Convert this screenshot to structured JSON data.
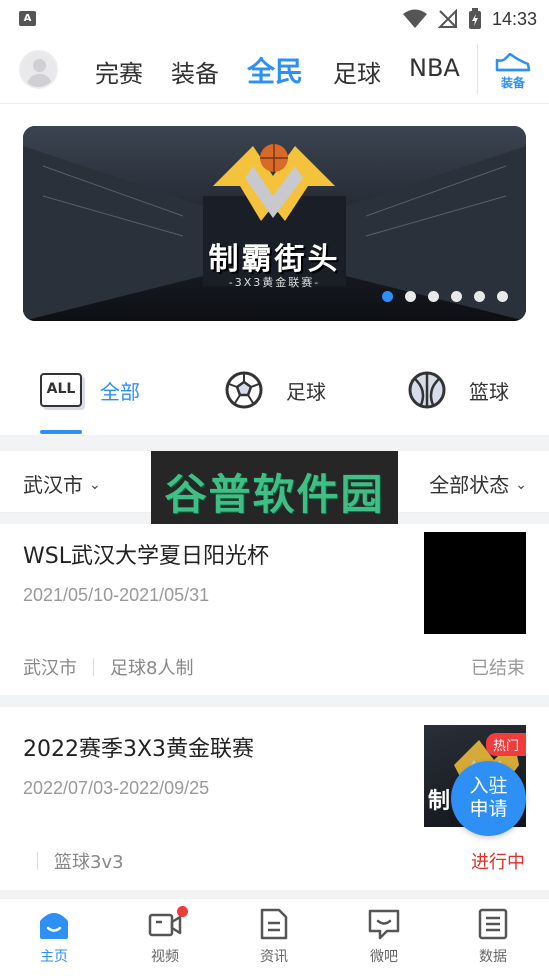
{
  "status_bar": {
    "time": "14:33",
    "left_icon": "A"
  },
  "top_nav": {
    "tabs": [
      "完赛",
      "装备",
      "全民",
      "足球",
      "NBA"
    ],
    "active_tab": "全民",
    "shoe_label": "装备",
    "accent_color": "#2e8ff5"
  },
  "banner": {
    "title": "制霸街头",
    "subtitle": "-3X3黄金联赛-",
    "dot_count": 6,
    "active_dot": 0
  },
  "sport_tabs": [
    {
      "label": "全部",
      "icon": "ALL",
      "active": true
    },
    {
      "label": "足球",
      "icon": "soccer-ball-icon",
      "active": false
    },
    {
      "label": "篮球",
      "icon": "basketball-icon",
      "active": false
    }
  ],
  "filters": {
    "city": "武汉市",
    "status": "全部状态"
  },
  "watermark": "谷普软件园",
  "events": [
    {
      "title": "WSL武汉大学夏日阳光杯",
      "dates": "2021/05/10-2021/05/31",
      "city": "武汉市",
      "type": "足球8人制",
      "status": "已结束",
      "status_color": "#999999"
    },
    {
      "title": "2022赛季3X3黄金联赛",
      "dates": "2022/07/03-2022/09/25",
      "city": "",
      "type": "篮球3v3",
      "status": "进行中",
      "status_color": "#e0302a",
      "badge": "热门",
      "thumb_text": "制"
    }
  ],
  "join_button": {
    "line1": "入驻",
    "line2": "申请"
  },
  "bottom_bar": [
    {
      "label": "主页",
      "icon": "home-icon",
      "active": true
    },
    {
      "label": "视频",
      "icon": "video-icon",
      "active": false,
      "dot": true
    },
    {
      "label": "资讯",
      "icon": "news-icon",
      "active": false
    },
    {
      "label": "微吧",
      "icon": "forum-icon",
      "active": false
    },
    {
      "label": "数据",
      "icon": "data-icon",
      "active": false
    }
  ]
}
